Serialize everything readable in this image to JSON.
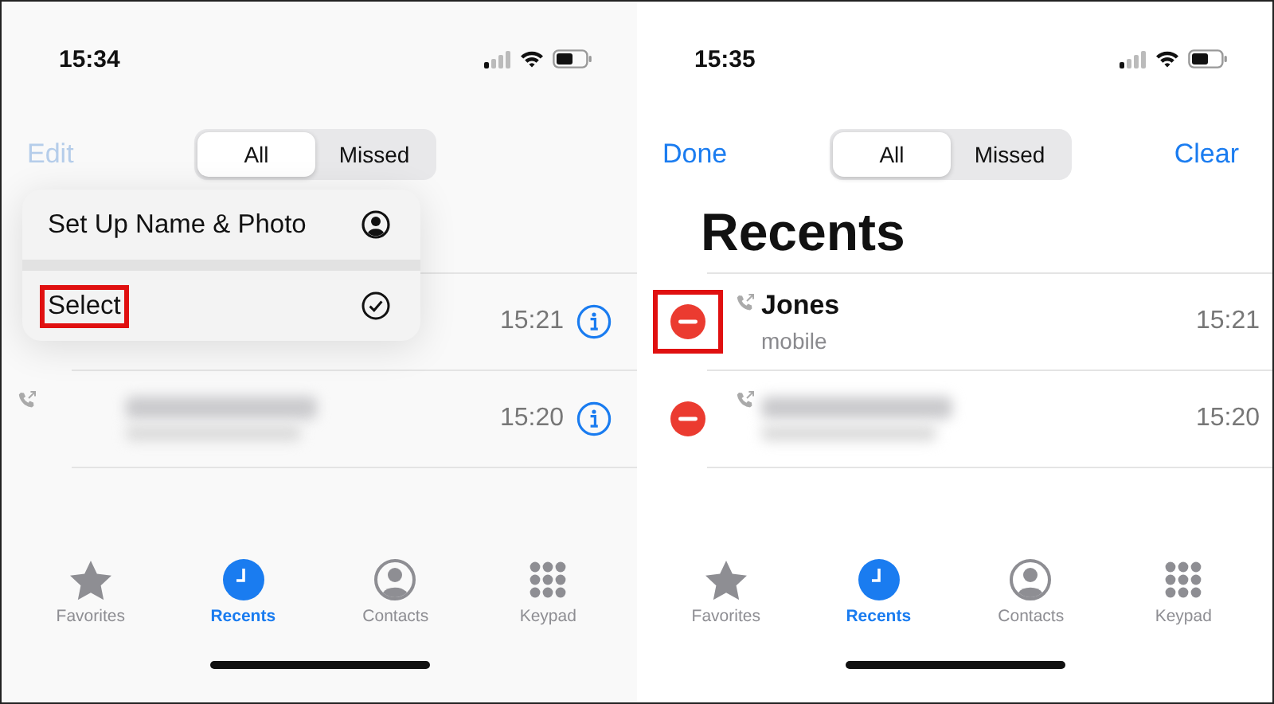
{
  "screens": [
    {
      "status_time": "15:34",
      "nav_left": {
        "label": "Edit",
        "dimmed": true
      },
      "segments": [
        {
          "label": "All",
          "selected": true
        },
        {
          "label": "Missed",
          "selected": false
        }
      ],
      "menu": [
        {
          "label": "Set Up Name & Photo",
          "annotated": false
        },
        {
          "label": "Select",
          "annotated": true
        }
      ],
      "rows": [
        {
          "kind": "hidden",
          "time": "15:21",
          "info_button": true
        },
        {
          "kind": "blurred",
          "time": "15:20",
          "info_button": true
        }
      ],
      "tabs": [
        {
          "label": "Favorites",
          "selected": false
        },
        {
          "label": "Recents",
          "selected": true
        },
        {
          "label": "Contacts",
          "selected": false
        },
        {
          "label": "Keypad",
          "selected": false
        }
      ]
    },
    {
      "status_time": "15:35",
      "nav_left": {
        "label": "Done",
        "dimmed": false
      },
      "nav_right": {
        "label": "Clear"
      },
      "segments": [
        {
          "label": "All",
          "selected": true
        },
        {
          "label": "Missed",
          "selected": false
        }
      ],
      "title": "Recents",
      "rows": [
        {
          "kind": "named",
          "name": "Jones",
          "detail": "mobile",
          "time": "15:21",
          "delete_control": true,
          "annotated": true
        },
        {
          "kind": "blurred",
          "time": "15:20",
          "delete_control": true
        }
      ],
      "tabs": [
        {
          "label": "Favorites",
          "selected": false
        },
        {
          "label": "Recents",
          "selected": true
        },
        {
          "label": "Contacts",
          "selected": false
        },
        {
          "label": "Keypad",
          "selected": false
        }
      ]
    }
  ]
}
